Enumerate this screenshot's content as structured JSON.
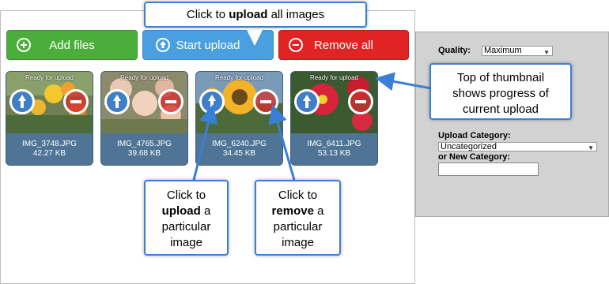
{
  "buttons": {
    "add_label": "Add files",
    "start_label": "Start upload",
    "remove_label": "Remove all"
  },
  "thumbnails": [
    {
      "status": "Ready for upload",
      "filename": "IMG_3748.JPG",
      "size": "42.27 KB",
      "photo": "flowers-yellow-orange"
    },
    {
      "status": "Ready for upload",
      "filename": "IMG_4765.JPG",
      "size": "39.68 KB",
      "photo": "roses-peach"
    },
    {
      "status": "Ready for upload",
      "filename": "IMG_6240.JPG",
      "size": "34.45 KB",
      "photo": "sunflower"
    },
    {
      "status": "Ready for upload",
      "filename": "IMG_6411.JPG",
      "size": "53.13 KB",
      "photo": "red-gerbera"
    }
  ],
  "settings": {
    "quality_label": "Quality:",
    "quality_value": "Maximum",
    "category_label": "Upload Category:",
    "category_value": "Uncategorized",
    "new_category_label": "or New Category:",
    "new_category_value": ""
  },
  "callouts": {
    "top_pre": "Click to ",
    "top_bold": "upload",
    "top_post": " all images",
    "thumb_line1": "Top of thumbnail",
    "thumb_line2": "shows progress of",
    "thumb_line3": "current upload",
    "up_line1": "Click to",
    "up_bold": "upload",
    "up_line2_post": " a",
    "up_line3": "particular",
    "up_line4": "image",
    "rm_line1": "Click to",
    "rm_bold": "remove",
    "rm_line2_post": " a",
    "rm_line3": "particular",
    "rm_line4": "image"
  },
  "colors": {
    "add": "#4cae3a",
    "start": "#4a9fe0",
    "remove": "#e02424",
    "thumb_bg": "#4f7496",
    "callout_border": "#3a7fd6",
    "settings_bg": "#d2d2d2"
  }
}
